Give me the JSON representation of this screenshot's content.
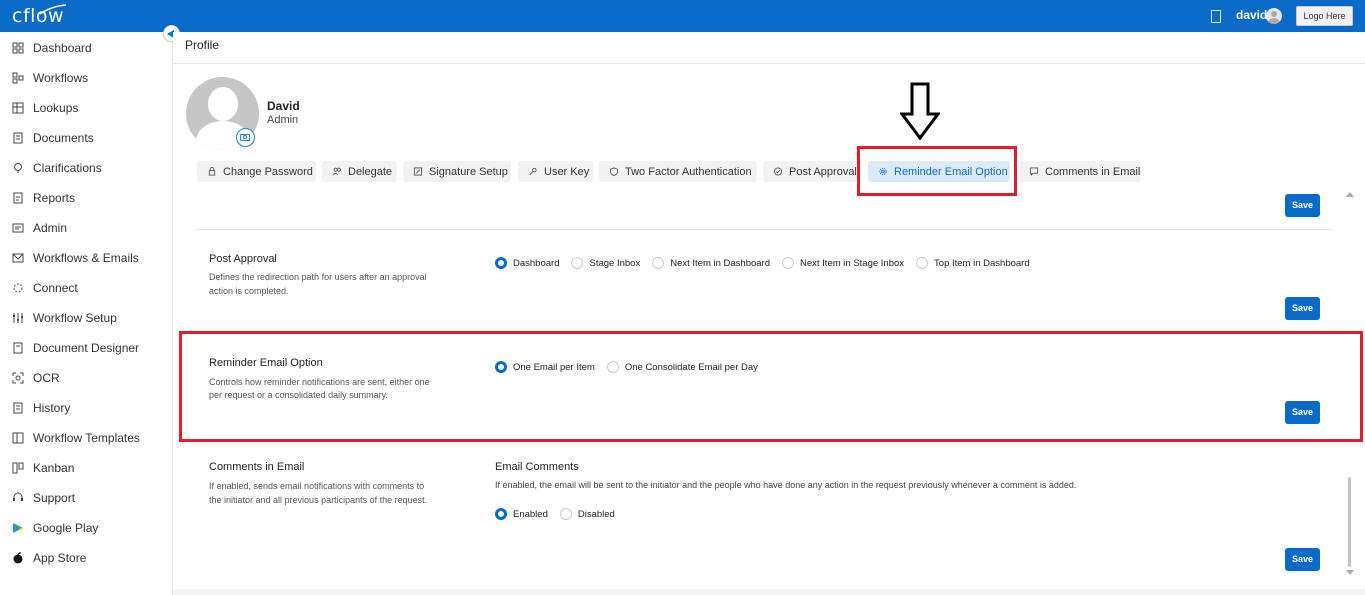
{
  "app": {
    "logo": "cflow",
    "user_name": "david",
    "logo_button": "Logo Here",
    "colors": {
      "brand": "#0a6ac7",
      "highlight": "#e01e2d"
    }
  },
  "sidebar": {
    "items": [
      {
        "label": "Dashboard",
        "icon": "dashboard-icon"
      },
      {
        "label": "Workflows",
        "icon": "workflows-icon"
      },
      {
        "label": "Lookups",
        "icon": "lookups-icon"
      },
      {
        "label": "Documents",
        "icon": "documents-icon"
      },
      {
        "label": "Clarifications",
        "icon": "clarifications-icon"
      },
      {
        "label": "Reports",
        "icon": "reports-icon"
      },
      {
        "label": "Admin",
        "icon": "admin-icon"
      },
      {
        "label": "Workflows & Emails",
        "icon": "mail-icon"
      },
      {
        "label": "Connect",
        "icon": "connect-icon"
      },
      {
        "label": "Workflow Setup",
        "icon": "sliders-icon"
      },
      {
        "label": "Document Designer",
        "icon": "document-designer-icon"
      },
      {
        "label": "OCR",
        "icon": "ocr-icon"
      },
      {
        "label": "History",
        "icon": "history-icon"
      },
      {
        "label": "Workflow Templates",
        "icon": "templates-icon"
      },
      {
        "label": "Kanban",
        "icon": "kanban-icon"
      },
      {
        "label": "Support",
        "icon": "support-icon"
      },
      {
        "label": "Google Play",
        "icon": "google-play-icon"
      },
      {
        "label": "App Store",
        "icon": "apple-icon"
      }
    ]
  },
  "page": {
    "title": "Profile"
  },
  "profile": {
    "name": "David",
    "role": "Admin"
  },
  "tabs": [
    {
      "label": "Change Password",
      "icon": "lock-icon"
    },
    {
      "label": "Delegate",
      "icon": "users-icon"
    },
    {
      "label": "Signature Setup",
      "icon": "signature-icon"
    },
    {
      "label": "User Key",
      "icon": "key-icon"
    },
    {
      "label": "Two Factor Authentication",
      "icon": "shield-icon"
    },
    {
      "label": "Post Approval",
      "icon": "check-circle-icon"
    },
    {
      "label": "Reminder Email Option",
      "icon": "gear-icon",
      "active": true
    },
    {
      "label": "Comments in Email",
      "icon": "comment-icon"
    }
  ],
  "sections": {
    "save_label": "Save",
    "post_approval": {
      "title": "Post Approval",
      "description_line1": "Defines the redirection path for users after an approval",
      "description_line2": "action is completed.",
      "options": [
        "Dashboard",
        "Stage Inbox",
        "Next Item in Dashboard",
        "Next Item in Stage Inbox",
        "Top Item in Dashboard"
      ],
      "selected": "Dashboard"
    },
    "reminder_email": {
      "title": "Reminder Email Option",
      "description_line1": "Controls how reminder notifications are sent, either one",
      "description_line2": "per request or a consolidated daily summary.",
      "options": [
        "One Email per Item",
        "One Consolidate Email per Day"
      ],
      "selected": "One Email per Item"
    },
    "comments_email": {
      "title": "Comments in Email",
      "description_line1": "If enabled, sends email notifications with comments to",
      "description_line2": "the initiator and all previous participants of the request.",
      "sub_heading": "Email Comments",
      "sub_description": "If enabled, the email will be sent to the initiator and the people who have done any action in the request previously whenever a comment is added.",
      "options": [
        "Enabled",
        "Disabled"
      ],
      "selected": "Enabled"
    }
  }
}
